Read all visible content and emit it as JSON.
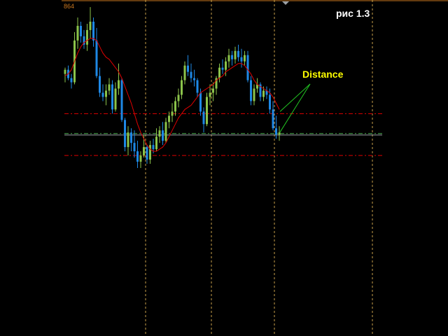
{
  "figure_label": "рис 1.3",
  "price_label": "864",
  "chart_data": {
    "type": "candlestick",
    "annotations": [
      {
        "text": "Distance",
        "color": "#ffff00"
      }
    ],
    "colors": {
      "background": "#000000",
      "bull_candle": "#8bc34a",
      "bear_candle": "#1e88e5",
      "moving_average": "#e00000",
      "level_lines": "#e00000",
      "current_price_line": "#9aa0a6",
      "mid_level_line": "#4caf50",
      "time_separators": "#c8a04a",
      "annotation_lines": "#22c422",
      "top_border": "#c8761e"
    },
    "price_range": [
      0,
      100
    ],
    "upper_level": 62,
    "mid_level": 52.5,
    "current_price": 51.8,
    "lower_level": 42,
    "candles": [
      [
        81,
        84,
        77,
        83
      ],
      [
        83,
        85,
        78,
        79
      ],
      [
        79,
        81,
        74,
        77
      ],
      [
        77,
        101,
        76,
        97
      ],
      [
        97,
        108,
        93,
        104
      ],
      [
        104,
        106,
        96,
        99
      ],
      [
        99,
        102,
        93,
        95
      ],
      [
        95,
        105,
        92,
        102
      ],
      [
        102,
        113,
        98,
        106
      ],
      [
        106,
        108,
        94,
        97
      ],
      [
        97,
        103,
        79,
        80
      ],
      [
        80,
        84,
        70,
        72
      ],
      [
        72,
        76,
        68,
        70
      ],
      [
        70,
        76,
        66,
        73
      ],
      [
        73,
        79,
        71,
        76
      ],
      [
        76,
        78,
        62,
        64
      ],
      [
        64,
        77,
        63,
        74
      ],
      [
        74,
        86,
        71,
        78
      ],
      [
        78,
        79,
        58,
        59
      ],
      [
        59,
        60,
        44,
        46
      ],
      [
        46,
        56,
        42,
        53
      ],
      [
        53,
        55,
        44,
        48
      ],
      [
        48,
        54,
        41,
        44
      ],
      [
        44,
        49,
        36,
        39
      ],
      [
        39,
        44,
        36,
        42
      ],
      [
        42,
        52,
        41,
        46
      ],
      [
        46,
        47,
        38,
        40
      ],
      [
        40,
        49,
        38,
        47
      ],
      [
        47,
        50,
        43,
        45
      ],
      [
        45,
        55,
        44,
        51
      ],
      [
        51,
        56,
        48,
        54
      ],
      [
        54,
        58,
        47,
        49
      ],
      [
        49,
        60,
        48,
        58
      ],
      [
        58,
        63,
        55,
        61
      ],
      [
        61,
        67,
        58,
        63
      ],
      [
        63,
        70,
        61,
        68
      ],
      [
        68,
        74,
        65,
        71
      ],
      [
        71,
        80,
        69,
        78
      ],
      [
        78,
        87,
        76,
        85
      ],
      [
        85,
        90,
        80,
        82
      ],
      [
        82,
        86,
        77,
        79
      ],
      [
        79,
        83,
        75,
        78
      ],
      [
        78,
        79,
        70,
        72
      ],
      [
        72,
        74,
        61,
        63
      ],
      [
        63,
        65,
        53,
        57
      ],
      [
        57,
        72,
        56,
        70
      ],
      [
        70,
        76,
        66,
        72
      ],
      [
        72,
        77,
        68,
        74
      ],
      [
        74,
        80,
        71,
        79
      ],
      [
        79,
        86,
        77,
        84
      ],
      [
        84,
        88,
        81,
        83
      ],
      [
        83,
        89,
        80,
        87
      ],
      [
        87,
        93,
        84,
        90
      ],
      [
        90,
        92,
        85,
        88
      ],
      [
        88,
        94,
        86,
        92
      ],
      [
        92,
        95,
        87,
        89
      ],
      [
        89,
        93,
        84,
        87
      ],
      [
        87,
        92,
        85,
        90
      ],
      [
        90,
        92,
        77,
        78
      ],
      [
        78,
        80,
        66,
        68
      ],
      [
        68,
        76,
        66,
        74
      ],
      [
        74,
        79,
        72,
        76
      ],
      [
        76,
        77,
        68,
        70
      ],
      [
        70,
        75,
        68,
        73
      ],
      [
        73,
        75,
        69,
        71
      ],
      [
        71,
        74,
        62,
        64
      ],
      [
        64,
        68,
        54,
        55
      ],
      [
        55,
        61,
        50,
        52
      ],
      [
        52,
        56,
        49,
        53
      ]
    ],
    "moving_average": [
      80,
      81,
      83,
      87,
      91,
      94,
      96,
      97,
      98,
      98,
      97,
      94,
      91,
      89,
      88,
      86,
      84,
      82,
      79,
      75,
      71,
      67,
      62,
      57,
      53,
      50,
      47,
      45,
      44,
      44,
      45,
      46,
      48,
      51,
      54,
      57,
      60,
      62,
      64,
      65,
      66,
      68,
      70,
      72,
      73,
      74,
      75,
      76,
      78,
      79,
      80,
      82,
      83,
      84,
      85,
      86,
      86,
      85,
      83,
      81,
      78,
      76,
      75,
      74,
      73,
      72,
      70,
      67,
      64
    ],
    "time_separator_indices": [
      25.5,
      46.5,
      66.5,
      97.5
    ]
  }
}
